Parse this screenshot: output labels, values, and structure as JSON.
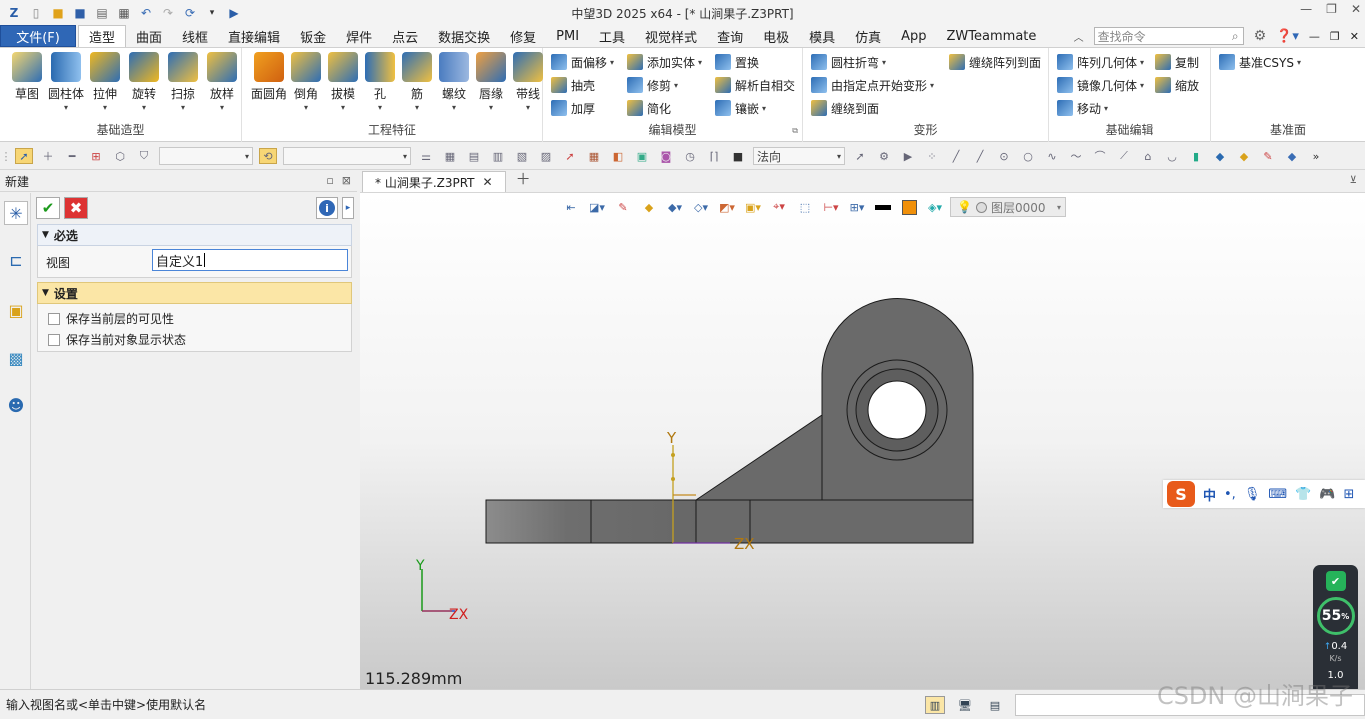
{
  "title": "中望3D 2025 x64 - [* 山涧果子.Z3PRT]",
  "colors": {
    "accent": "#2f67b6",
    "part_fill": "#6b6b6b",
    "part_stroke": "#1a1a1a",
    "setting_head": "#fbe6a6"
  },
  "menu": {
    "file": "文件(F)",
    "tabs": [
      "造型",
      "曲面",
      "线框",
      "直接编辑",
      "钣金",
      "焊件",
      "点云",
      "数据交换",
      "修复",
      "PMI",
      "工具",
      "视觉样式",
      "查询",
      "电极",
      "模具",
      "仿真",
      "App",
      "ZWTeammate"
    ],
    "active": "造型",
    "search_placeholder": "查找命令"
  },
  "ribbon": {
    "groups": {
      "basic": "基础造型",
      "feature": "工程特征",
      "edit": "编辑模型",
      "deform": "变形",
      "basic_edit": "基础编辑",
      "datum": "基准面"
    },
    "basic_buttons": [
      "草图",
      "圆柱体",
      "拉伸",
      "旋转",
      "扫掠",
      "放样"
    ],
    "feature_buttons": [
      "面圆角",
      "倒角",
      "拔模",
      "孔",
      "筋",
      "螺纹",
      "唇缘",
      "带线"
    ],
    "edit_small": [
      "面偏移",
      "添加实体",
      "置换",
      "抽壳",
      "修剪",
      "解析自相交",
      "加厚",
      "简化",
      "镶嵌"
    ],
    "deform_small": [
      "圆柱折弯",
      "缠绕阵列到面",
      "由指定点开始变形",
      "缠绕到面"
    ],
    "basic_edit_small": [
      "阵列几何体",
      "复制",
      "镜像几何体",
      "缩放",
      "移动"
    ],
    "datum_small": [
      "基准CSYS"
    ]
  },
  "toolbar": {
    "view_select": "法向"
  },
  "left_panel": {
    "title": "新建",
    "required": "必选",
    "view_label": "视图",
    "view_value": "自定义1",
    "settings": "设置",
    "checkbox1": "保存当前层的可见性",
    "checkbox2": "保存当前对象显示状态"
  },
  "doc_tab": "* 山涧果子.Z3PRT",
  "viewport": {
    "layer": "图层0000",
    "scale": "115.289mm",
    "axis_y": "Y",
    "axis_zx": "ZX"
  },
  "ime": {
    "lang": "中"
  },
  "monitor": {
    "percent": "55",
    "percent_unit": "%",
    "up": "0.4",
    "down": "1.0",
    "unit": "K/s"
  },
  "status": {
    "message": "输入视图名或<单击中键>使用默认名"
  },
  "watermark": "CSDN @山涧果子"
}
